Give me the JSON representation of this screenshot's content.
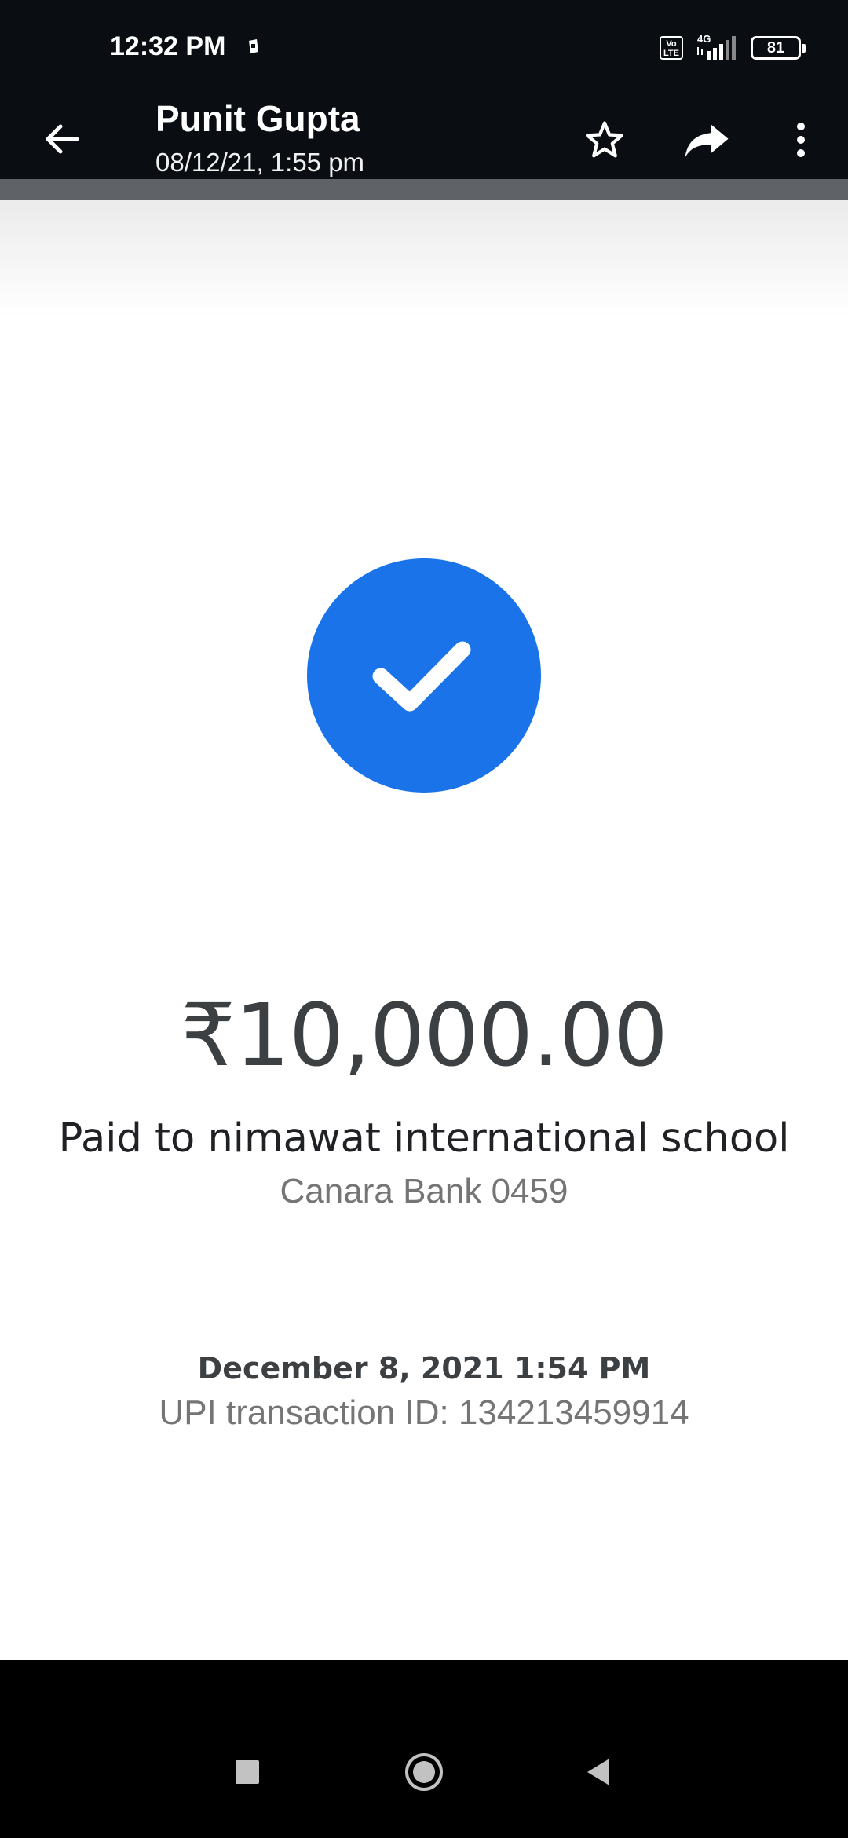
{
  "status_bar": {
    "time": "12:32 PM",
    "network": "4G",
    "volte_top": "Vo",
    "volte_bottom": "LTE",
    "battery": "81"
  },
  "app_bar": {
    "title": "Punit Gupta",
    "subtitle": "08/12/21, 1:55 pm",
    "icons": [
      "back-arrow-icon",
      "star-icon",
      "share-icon",
      "more-vert-icon"
    ]
  },
  "receipt": {
    "amount": "₹10,000.00",
    "paid_to": "Paid to nimawat international school",
    "bank": "Canara Bank 0459",
    "date": "December 8, 2021 1:54 PM",
    "transaction_id": "UPI transaction ID: 134213459914",
    "accent_color": "#1a73e8"
  },
  "nav_bar": {
    "icons": [
      "recents-square-icon",
      "home-circle-icon",
      "back-triangle-icon"
    ]
  }
}
